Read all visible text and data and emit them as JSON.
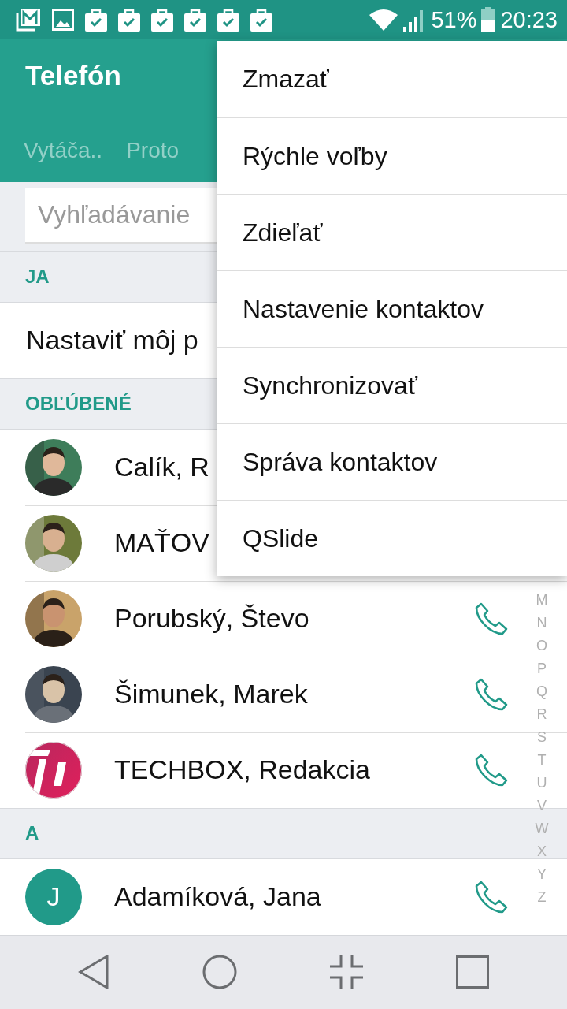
{
  "status_bar": {
    "battery": "51%",
    "time": "20:23"
  },
  "app_bar": {
    "title": "Telefón",
    "tabs": [
      {
        "label": "Vytáča..",
        "selected": false
      },
      {
        "label": "Proto",
        "selected": false
      }
    ]
  },
  "search": {
    "placeholder": "Vyhľadávanie"
  },
  "sections": [
    {
      "header": "JA",
      "rows": [
        {
          "kind": "action",
          "name": "Nastaviť môj p",
          "call": false
        }
      ]
    },
    {
      "header": "OBĽÚBENÉ",
      "rows": [
        {
          "name": "Calík, R",
          "call": false
        },
        {
          "name": "MAŤOV",
          "call": false
        },
        {
          "name": "Porubský, Števo",
          "call": true
        },
        {
          "name": "Šimunek, Marek",
          "call": true
        },
        {
          "kind": "logo",
          "name": "TECHBOX, Redakcia",
          "call": true
        }
      ]
    },
    {
      "header": "A",
      "rows": [
        {
          "kind": "initial",
          "initial": "J",
          "name": "Adamíková, Jana",
          "call": true
        }
      ]
    }
  ],
  "index_letters": [
    "M",
    "N",
    "O",
    "P",
    "Q",
    "R",
    "S",
    "T",
    "U",
    "V",
    "W",
    "X",
    "Y",
    "Z"
  ],
  "menu": {
    "items": [
      "Zmazať",
      "Rýchle voľby",
      "Zdieľať",
      "Nastavenie kontaktov",
      "Synchronizovať",
      "Správa kontaktov",
      "QSlide"
    ]
  }
}
